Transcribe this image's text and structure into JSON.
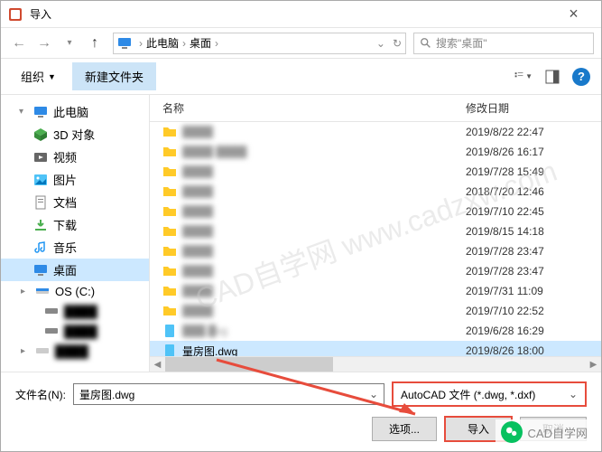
{
  "window": {
    "title": "导入"
  },
  "breadcrumb": {
    "item1": "此电脑",
    "item2": "桌面"
  },
  "search": {
    "placeholder": "搜索\"桌面\""
  },
  "toolbar": {
    "organize": "组织",
    "newFolder": "新建文件夹"
  },
  "sidebar": {
    "thispc": "此电脑",
    "threeD": "3D 对象",
    "video": "视频",
    "pictures": "图片",
    "documents": "文档",
    "downloads": "下载",
    "music": "音乐",
    "desktop": "桌面",
    "osc": "OS (C:)",
    "blur1": "████",
    "blur2": "████",
    "blur3": "████"
  },
  "listHeader": {
    "name": "名称",
    "date": "修改日期"
  },
  "files": [
    {
      "name": "████",
      "date": "2019/8/22 22:47",
      "type": "folder",
      "blur": true
    },
    {
      "name": "████ ████",
      "date": "2019/8/26 16:17",
      "type": "folder",
      "blur": true
    },
    {
      "name": "████",
      "date": "2019/7/28 15:49",
      "type": "folder",
      "blur": true
    },
    {
      "name": "████",
      "date": "2018/7/20 12:46",
      "type": "folder",
      "blur": true
    },
    {
      "name": "████",
      "date": "2019/7/10 22:45",
      "type": "folder",
      "blur": true
    },
    {
      "name": "████",
      "date": "2019/8/15 14:18",
      "type": "folder",
      "blur": true
    },
    {
      "name": "████",
      "date": "2019/7/28 23:47",
      "type": "folder",
      "blur": true
    },
    {
      "name": "████",
      "date": "2019/7/28 23:47",
      "type": "folder",
      "blur": true
    },
    {
      "name": "████",
      "date": "2019/7/31 11:09",
      "type": "folder",
      "blur": true
    },
    {
      "name": "████",
      "date": "2019/7/10 22:52",
      "type": "folder",
      "blur": true
    },
    {
      "name": "███.█vg",
      "date": "2019/6/28 16:29",
      "type": "file",
      "blur": true
    },
    {
      "name": "量房图.dwg",
      "date": "2019/8/26 18:00",
      "type": "file",
      "blur": false,
      "selected": true
    }
  ],
  "footer": {
    "fileNameLabel": "文件名(N):",
    "fileNameValue": "量房图.dwg",
    "filterValue": "AutoCAD 文件 (*.dwg, *.dxf)",
    "options": "选项...",
    "import": "导入",
    "cancel": "取消"
  },
  "watermark": "CAD自学网 www.cadzxw.com",
  "wechat": "CAD自学网"
}
